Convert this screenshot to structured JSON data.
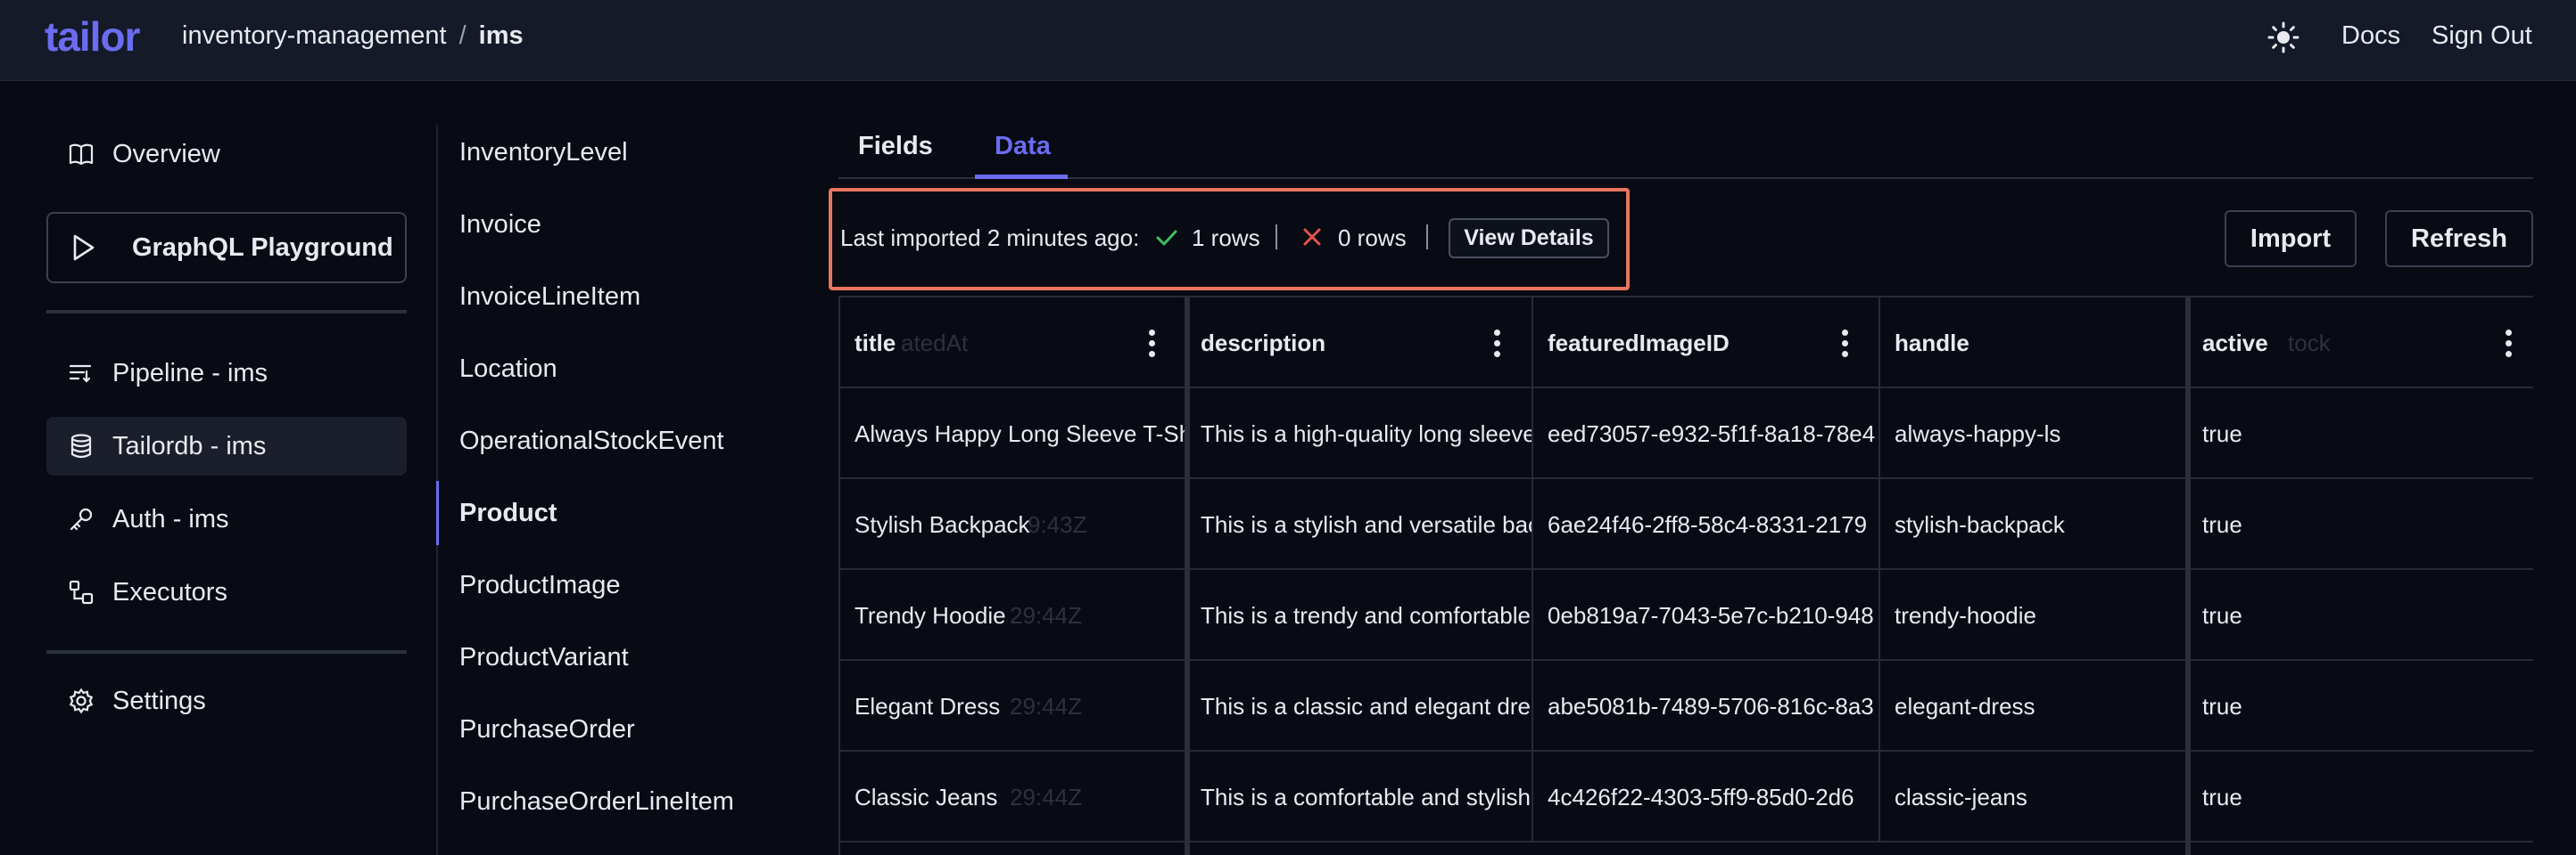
{
  "header": {
    "logo": "tailor",
    "breadcrumb_project": "inventory-management",
    "breadcrumb_separator": "/",
    "breadcrumb_app": "ims",
    "docs_label": "Docs",
    "signout_label": "Sign Out"
  },
  "sidebar": {
    "overview": "Overview",
    "playground": "GraphQL Playground",
    "pipeline": "Pipeline -  ims",
    "tailordb": "Tailordb -  ims",
    "auth": "Auth -  ims",
    "executors": "Executors",
    "settings": "Settings"
  },
  "types": [
    "InventoryLevel",
    "Invoice",
    "InvoiceLineItem",
    "Location",
    "OperationalStockEvent",
    "Product",
    "ProductImage",
    "ProductVariant",
    "PurchaseOrder",
    "PurchaseOrderLineItem"
  ],
  "active_type": "Product",
  "tabs": {
    "fields": "Fields",
    "data": "Data",
    "active": "Data"
  },
  "import_status": {
    "text": "Last imported 2 minutes ago:",
    "ok_count": "1 rows",
    "error_count": "0 rows",
    "view_details": "View Details"
  },
  "actions": {
    "import": "Import",
    "refresh": "Refresh"
  },
  "table": {
    "columns": [
      "title",
      "description",
      "featuredImageID",
      "handle",
      "active"
    ],
    "ghost_headers": [
      "atedAt",
      "tock"
    ],
    "rows": [
      [
        "Always Happy Long Sleeve T-Shirt",
        "This is a high-quality long sleeve",
        "eed73057-e932-5f1f-8a18-78e4",
        "always-happy-ls",
        "true"
      ],
      [
        "Stylish Backpack",
        "This is a stylish and versatile backpack",
        "6ae24f46-2ff8-58c4-8331-2179",
        "stylish-backpack",
        "true"
      ],
      [
        "Trendy Hoodie",
        "This is a trendy and comfortable",
        "0eb819a7-7043-5e7c-b210-948",
        "trendy-hoodie",
        "true"
      ],
      [
        "Elegant Dress",
        "This is a classic and elegant dress",
        "abe5081b-7489-5706-816c-8a3",
        "elegant-dress",
        "true"
      ],
      [
        "Classic Jeans",
        "This is a comfortable and stylish",
        "4c426f22-4303-5ff9-85d0-2d6",
        "classic-jeans",
        "true"
      ]
    ],
    "ghost_cells": [
      "9:43Z",
      "29:44Z",
      "29:44Z",
      "29:44Z"
    ]
  },
  "colors": {
    "accent": "#6b6cf0",
    "highlight_border": "#e8755e",
    "success": "#3fbf5a",
    "error": "#e5534b"
  },
  "icons": [
    "book-icon",
    "play-icon",
    "pipeline-icon",
    "database-icon",
    "key-icon",
    "executors-icon",
    "gear-icon",
    "sun-icon",
    "check-icon",
    "x-icon",
    "kebab-icon"
  ]
}
